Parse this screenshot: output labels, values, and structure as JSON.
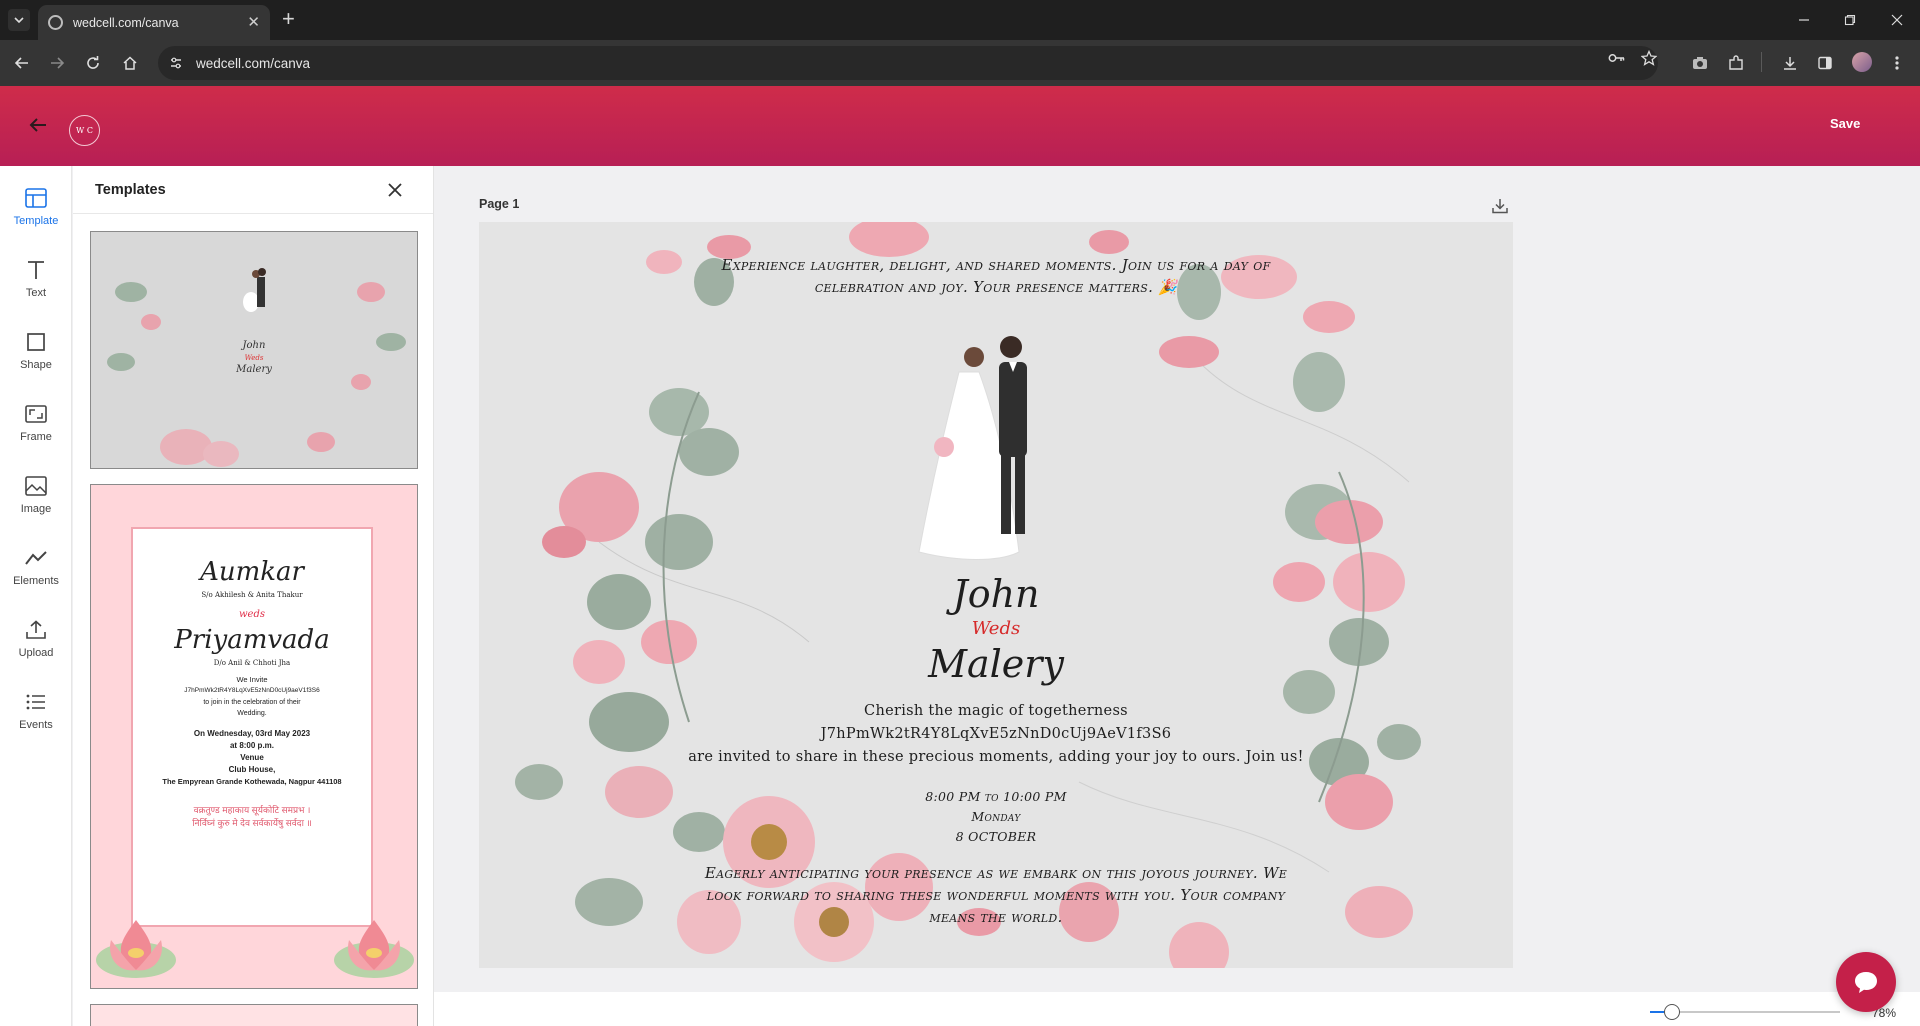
{
  "browser": {
    "tab_title": "wedcell.com/canva",
    "url": "wedcell.com/canva"
  },
  "header": {
    "logo_text": "W C",
    "save_label": "Save",
    "brand_color": "#c8264f"
  },
  "rail": {
    "items": [
      {
        "label": "Template",
        "icon": "template-icon",
        "active": true
      },
      {
        "label": "Text",
        "icon": "text-icon"
      },
      {
        "label": "Shape",
        "icon": "shape-icon"
      },
      {
        "label": "Frame",
        "icon": "frame-icon"
      },
      {
        "label": "Image",
        "icon": "image-icon"
      },
      {
        "label": "Elements",
        "icon": "elements-icon"
      },
      {
        "label": "Upload",
        "icon": "upload-icon"
      },
      {
        "label": "Events",
        "icon": "events-icon"
      }
    ]
  },
  "panel": {
    "title": "Templates",
    "template1": {
      "groom": "John",
      "weds": "Weds",
      "bride": "Malery"
    },
    "template2": {
      "groom": "Aumkar",
      "groom_parents": "S/o Akhilesh & Anita Thakur",
      "weds": "weds",
      "bride": "Priyamvada",
      "bride_parents": "D/o Anil & Chhoti Jha",
      "invite_line1": "We Invite",
      "invite_code": "J7hPmWk2tR4Y8LqXvE5zNnD0cUj9aeV1f3S6",
      "invite_line2": "to join in the celebration of their",
      "invite_line3": "Wedding.",
      "date": "On Wednesday, 03rd May 2023",
      "time": "at 8:00 p.m.",
      "venue_label": "Venue",
      "venue_name": "Club House,",
      "venue_address": "The Empyrean Grande Kothewada, Nagpur 441108",
      "shloka1": "वक्रतुण्ड महाकाय सूर्यकोटि समप्रभ ।",
      "shloka2": "निर्विघ्नं कुरु मे देव सर्वकार्येषु सर्वदा ॥"
    }
  },
  "canvas": {
    "page_label": "Page 1",
    "intro": "Experience laughter, delight, and shared moments. Join us for a day of celebration and joy. Your presence matters. 🎉",
    "groom": "John",
    "weds": "Weds",
    "bride": "Malery",
    "line1": "Cherish the magic of togetherness",
    "code": "J7hPmWk2tR4Y8LqXvE5zNnD0cUj9AeV1f3S6",
    "line2": "are invited to share in these precious moments, adding your joy to ours. Join us!",
    "time": "8:00 PM to 10:00 PM",
    "day": "Monday",
    "date": "8 OCTOBER",
    "closing": "Eagerly anticipating your presence as we embark on this joyous journey. We look forward to sharing these wonderful moments with you. Your company means the world.",
    "weds_color": "#d62a2a"
  },
  "zoom": {
    "label": "78%",
    "value": 0.78
  }
}
